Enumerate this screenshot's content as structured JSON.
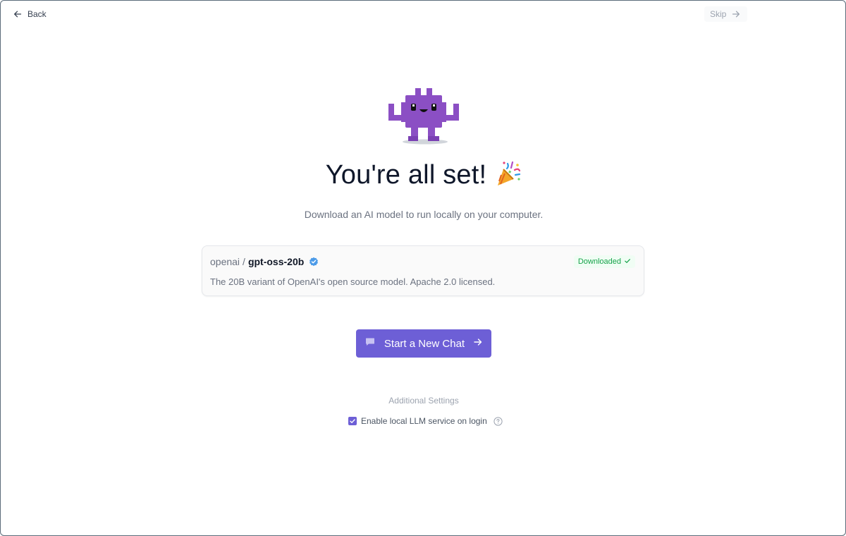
{
  "nav": {
    "back_label": "Back",
    "skip_label": "Skip"
  },
  "hero": {
    "title": "You're all set!",
    "subtitle": "Download an AI model to run locally on your computer."
  },
  "model": {
    "org": "openai",
    "separator": "/",
    "name": "gpt-oss-20b",
    "status": "Downloaded",
    "description": "The 20B variant of OpenAI's open source model. Apache 2.0 licensed."
  },
  "cta": {
    "start_label": "Start a New Chat"
  },
  "settings": {
    "title": "Additional Settings",
    "items": [
      {
        "label": "Enable local LLM service on login",
        "checked": true
      }
    ]
  },
  "colors": {
    "accent": "#6d5fd6",
    "mascot": "#8b4fc4",
    "success": "#16a34a"
  },
  "icons": {
    "back": "arrow-left-icon",
    "skip": "arrow-right-icon",
    "verified": "verified-badge-icon",
    "downloaded": "check-icon",
    "chat": "chat-bubble-icon",
    "start_arrow": "arrow-right-icon",
    "help": "help-circle-icon",
    "party": "party-popper-icon",
    "mascot": "robot-mascot-icon"
  }
}
